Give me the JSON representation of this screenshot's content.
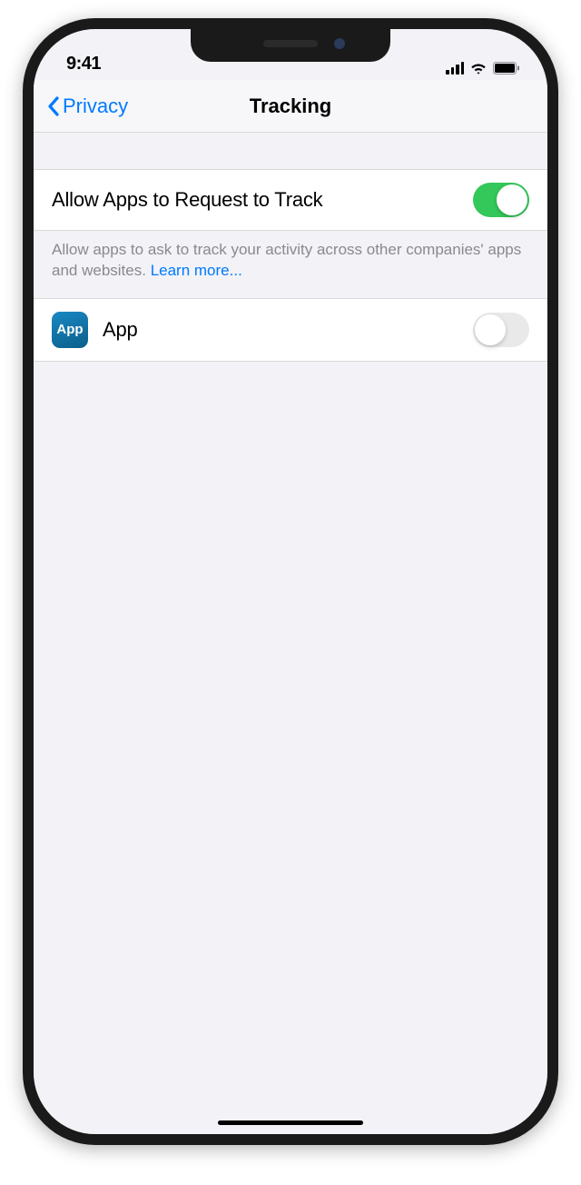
{
  "status_bar": {
    "time": "9:41"
  },
  "nav": {
    "back_label": "Privacy",
    "title": "Tracking"
  },
  "settings": {
    "allow_track": {
      "label": "Allow Apps to Request to Track",
      "enabled": true
    },
    "footer_text": "Allow apps to ask to track your activity across other companies' apps and websites. ",
    "footer_link": "Learn more...",
    "apps": [
      {
        "icon_label": "App",
        "name": "App",
        "enabled": false
      }
    ]
  }
}
